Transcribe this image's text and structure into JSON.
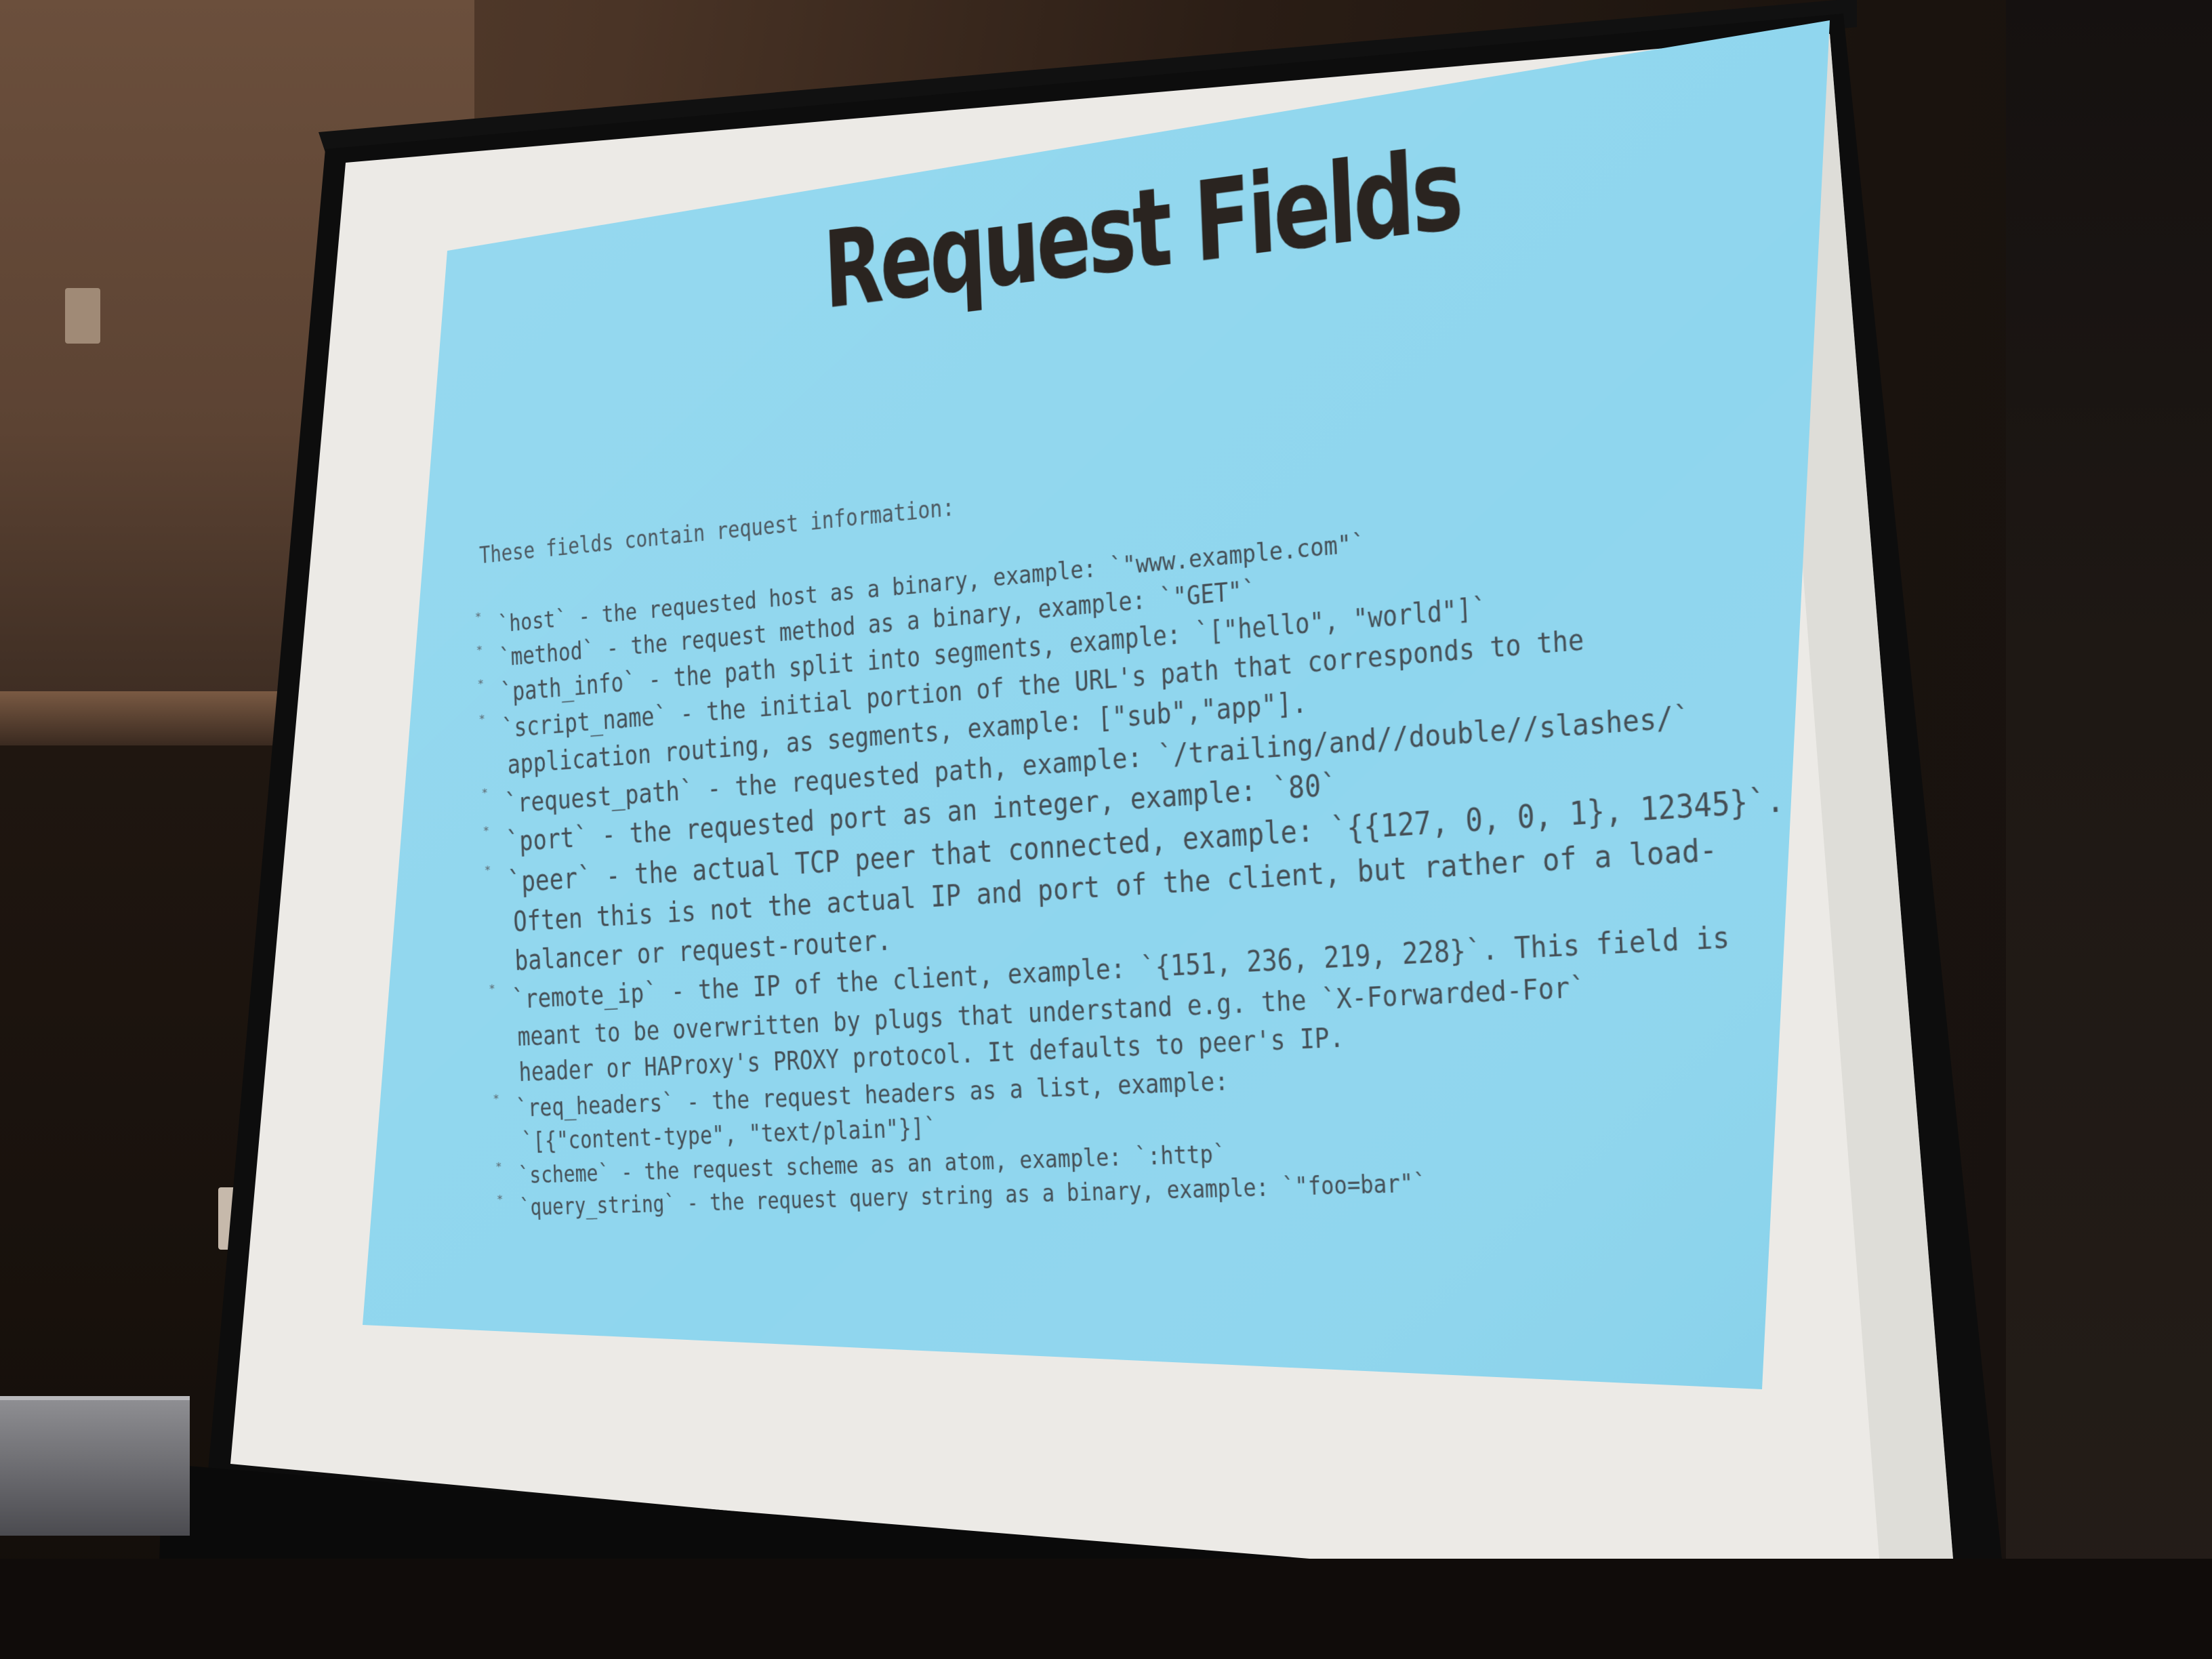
{
  "slide": {
    "title": "Request Fields",
    "intro": "These fields contain request information:",
    "items": [
      {
        "lines": [
          "`host` - the requested host as a binary, example: `\"www.example.com\"`"
        ]
      },
      {
        "lines": [
          "`method` - the request method as a binary, example: `\"GET\"`"
        ]
      },
      {
        "lines": [
          "`path_info` - the path split into segments, example: `[\"hello\", \"world\"]`"
        ]
      },
      {
        "lines": [
          "`script_name` - the initial portion of the URL's path that corresponds to the",
          "application routing, as segments, example: [\"sub\",\"app\"]."
        ]
      },
      {
        "lines": [
          "`request_path` - the requested path, example: `/trailing/and//double//slashes/`"
        ]
      },
      {
        "lines": [
          "`port` - the requested port as an integer, example: `80`"
        ]
      },
      {
        "lines": [
          "`peer` - the actual TCP peer that connected, example: `{{127, 0, 0, 1}, 12345}`.",
          "Often this is not the actual IP and port of the client, but rather of a load-",
          "balancer or request-router."
        ]
      },
      {
        "lines": [
          "`remote_ip` - the IP of the client, example: `{151, 236, 219, 228}`. This field is",
          "meant to be overwritten by plugs that understand e.g. the `X-Forwarded-For`",
          "header or HAProxy's PROXY protocol. It defaults to peer's IP."
        ]
      },
      {
        "lines": [
          "`req_headers` - the request headers as a list, example:",
          "`[{\"content-type\", \"text/plain\"}]`"
        ]
      },
      {
        "lines": [
          "`scheme` - the request scheme as an atom, example: `:http`"
        ]
      },
      {
        "lines": [
          "`query_string` - the request query string as a binary, example: `\"foo=bar\"`"
        ]
      }
    ],
    "bullet": "*"
  },
  "colors": {
    "slide_background": "#8fd6ee",
    "screen_border": "#f2f1ee",
    "title_text": "#2a2420",
    "body_text": "#444e55"
  }
}
